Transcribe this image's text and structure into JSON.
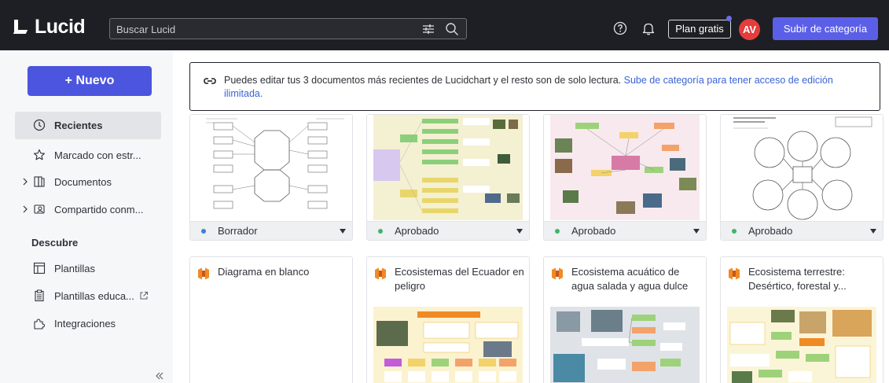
{
  "app": {
    "logo_text": "Lucid",
    "brand_color": "#4c55de"
  },
  "search": {
    "placeholder": "Buscar Lucid"
  },
  "header": {
    "plan_label": "Plan gratis",
    "avatar_initials": "AV",
    "upgrade_label": "Subir de categoría"
  },
  "sidebar": {
    "new_label": "+ Nuevo",
    "items": [
      {
        "label": "Recientes",
        "icon": "clock-icon",
        "active": true
      },
      {
        "label": "Marcado con estr...",
        "icon": "star-icon"
      },
      {
        "label": "Documentos",
        "icon": "documents-icon",
        "expandable": true
      },
      {
        "label": "Compartido conm...",
        "icon": "shared-icon",
        "expandable": true
      }
    ],
    "section_title": "Descubre",
    "discover_items": [
      {
        "label": "Plantillas",
        "icon": "template-icon"
      },
      {
        "label": "Plantillas educa...",
        "icon": "clipboard-icon",
        "external": true
      },
      {
        "label": "Integraciones",
        "icon": "puzzle-icon"
      }
    ]
  },
  "banner": {
    "text": "Puedes editar tus 3 documentos más recientes de Lucidchart y el resto son de solo lectura. ",
    "link_text": "Sube de categoría para tener acceso de edición ilimitada."
  },
  "documents": [
    {
      "status": "Borrador",
      "status_color": "#3f7de0"
    },
    {
      "status": "Aprobado",
      "status_color": "#3fb56a"
    },
    {
      "status": "Aprobado",
      "status_color": "#3fb56a"
    },
    {
      "status": "Aprobado",
      "status_color": "#3fb56a"
    }
  ],
  "templates": [
    {
      "title": "Diagrama en blanco"
    },
    {
      "title": "Ecosistemas del Ecuador en peligro"
    },
    {
      "title": "Ecosistema acuático de agua salada y agua dulce"
    },
    {
      "title": "Ecosistema terrestre: Desértico, forestal y..."
    }
  ]
}
